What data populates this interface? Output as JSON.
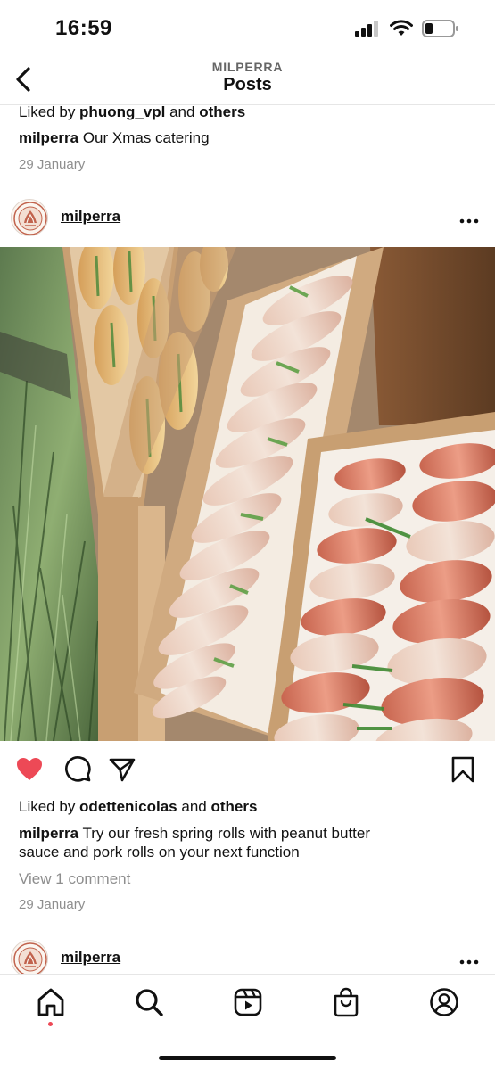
{
  "status_bar": {
    "time": "16:59"
  },
  "header": {
    "username": "MILPERRA",
    "title": "Posts"
  },
  "previous_post": {
    "likes_prefix": "Liked by ",
    "likes_user": "phuong_vpl",
    "likes_and": " and ",
    "likes_others": "others",
    "caption_user": "milperra",
    "caption_text": " Our Xmas catering",
    "date": "29 January"
  },
  "post": {
    "username": "milperra",
    "liked": true,
    "likes_prefix": "Liked by ",
    "likes_user": "odettenicolas",
    "likes_and": " and ",
    "likes_others": "others",
    "caption_user": "milperra",
    "caption_text": " Try our fresh spring rolls with peanut butter",
    "caption_text_2": "sauce and pork rolls on your next function",
    "view_comments": "View 1 comment",
    "date": "29 January"
  },
  "next_post": {
    "username": "milperra"
  },
  "tab_bar": {
    "tabs": [
      "home-icon",
      "search-icon",
      "reels-icon",
      "shop-icon",
      "profile-icon"
    ],
    "active": "home-icon"
  },
  "colors": {
    "like_red": "#ed4956",
    "muted_text": "#8e8e8e",
    "text": "#111111"
  }
}
